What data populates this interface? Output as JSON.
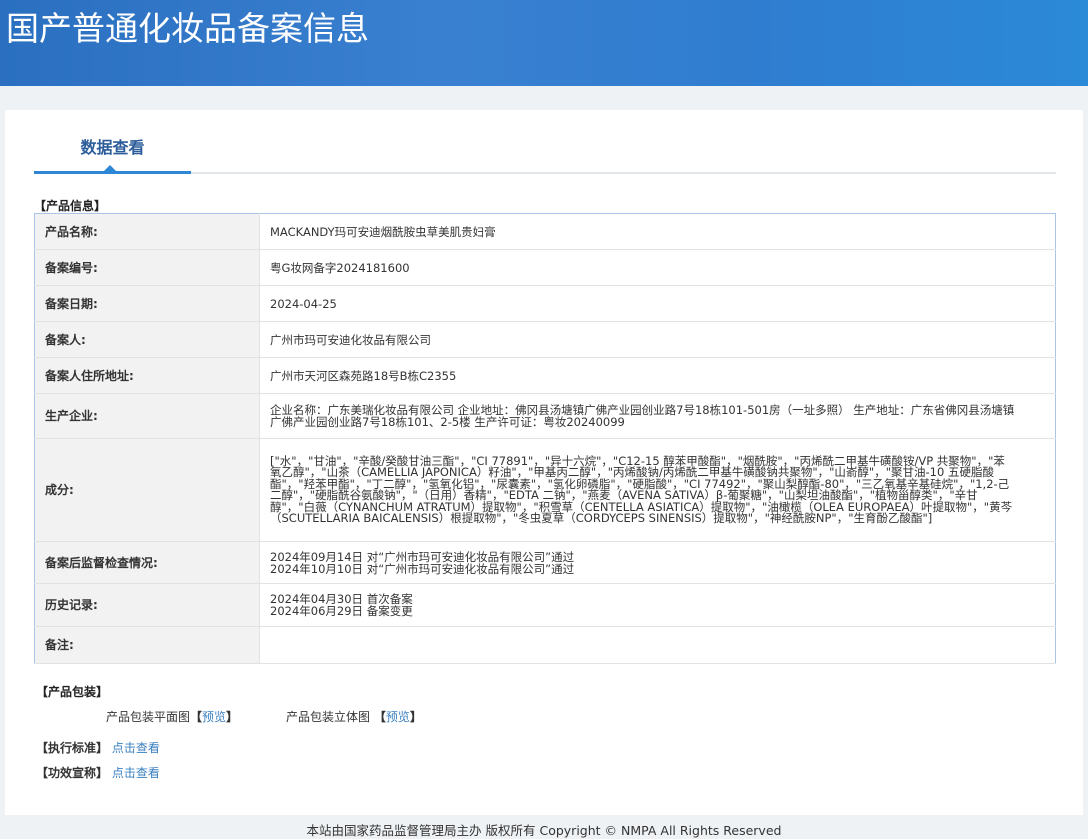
{
  "header": {
    "title": "国产普通化妆品备案信息"
  },
  "tab": {
    "label": "数据查看"
  },
  "product_info": {
    "section_title": "【产品信息】",
    "rows": [
      {
        "label": "产品名称:",
        "value": "MACKANDY玛可安迪烟酰胺虫草美肌贵妇膏"
      },
      {
        "label": "备案编号:",
        "value": "粤G妆网备字2024181600"
      },
      {
        "label": "备案日期:",
        "value": "2024-04-25"
      },
      {
        "label": "备案人:",
        "value": "广州市玛可安迪化妆品有限公司"
      },
      {
        "label": "备案人住所地址:",
        "value": "广州市天河区森苑路18号B栋C2355"
      },
      {
        "label": "生产企业:",
        "value": "企业名称：广东美瑞化妆品有限公司 企业地址：佛冈县汤塘镇广佛产业园创业路7号18栋101-501房（一址多照） 生产地址：广东省佛冈县汤塘镇广佛产业园创业路7号18栋101、2-5楼 生产许可证：粤妆20240099"
      },
      {
        "label": "成分:",
        "value": "[\"水\"，\"甘油\"，\"辛酸/癸酸甘油三酯\"，\"CI 77891\"，\"异十六烷\"，\"C12-15 醇苯甲酸酯\"，\"烟酰胺\"，\"丙烯酰二甲基牛磺酸铵/VP 共聚物\"，\"苯氧乙醇\"，\"山茶（CAMELLIA JAPONICA）籽油\"，\"甲基丙二醇\"，\"丙烯酸钠/丙烯酰二甲基牛磺酸钠共聚物\"，\"山嵛醇\"，\"聚甘油-10 五硬脂酸酯\"，\"羟苯甲酯\"，\"丁二醇\"，\"氢氧化铝\"，\"尿囊素\"，\"氢化卵磷脂\"，\"硬脂酸\"，\"CI 77492\"，\"聚山梨醇酯-80\"，\"三乙氧基辛基硅烷\"，\"1,2-己二醇\"，\"硬脂酰谷氨酸钠\"，\"（日用）香精\"，\"EDTA 二钠\"，\"燕麦（AVENA SATIVA）β-葡聚糖\"，\"山梨坦油酸酯\"，\"植物甾醇类\"，\"辛甘醇\"，\"白薇（CYNANCHUM ATRATUM）提取物\"，\"积雪草（CENTELLA ASIATICA）提取物\"，\"油橄榄（OLEA EUROPAEA）叶提取物\"，\"黄芩（SCUTELLARIA BAICALENSIS）根提取物\"，\"冬虫夏草（CORDYCEPS SINENSIS）提取物\"，\"神经酰胺NP\"，\"生育酚乙酸酯\"]"
      },
      {
        "label": "备案后监督检查情况:",
        "lines": [
          "2024年09月14日 对“广州市玛可安迪化妆品有限公司”通过",
          "2024年10月10日 对“广州市玛可安迪化妆品有限公司”通过"
        ]
      },
      {
        "label": "历史记录:",
        "lines": [
          "2024年04月30日 首次备案",
          "2024年06月29日 备案变更"
        ]
      },
      {
        "label": "备注:",
        "value": ""
      }
    ]
  },
  "packaging": {
    "section_title": "【产品包装】",
    "flat_label": "产品包装平面图",
    "flat_link": "预览",
    "solid_label": "产品包装立体图",
    "solid_link": "预览",
    "bracket_open": "【",
    "bracket_close": "】"
  },
  "standard": {
    "label": "【执行标准】",
    "link": "点击查看"
  },
  "efficacy": {
    "label": "【功效宣称】",
    "link": "点击查看"
  },
  "footer": {
    "text": "本站由国家药品监督管理局主办 版权所有 Copyright © NMPA All Rights Reserved"
  }
}
